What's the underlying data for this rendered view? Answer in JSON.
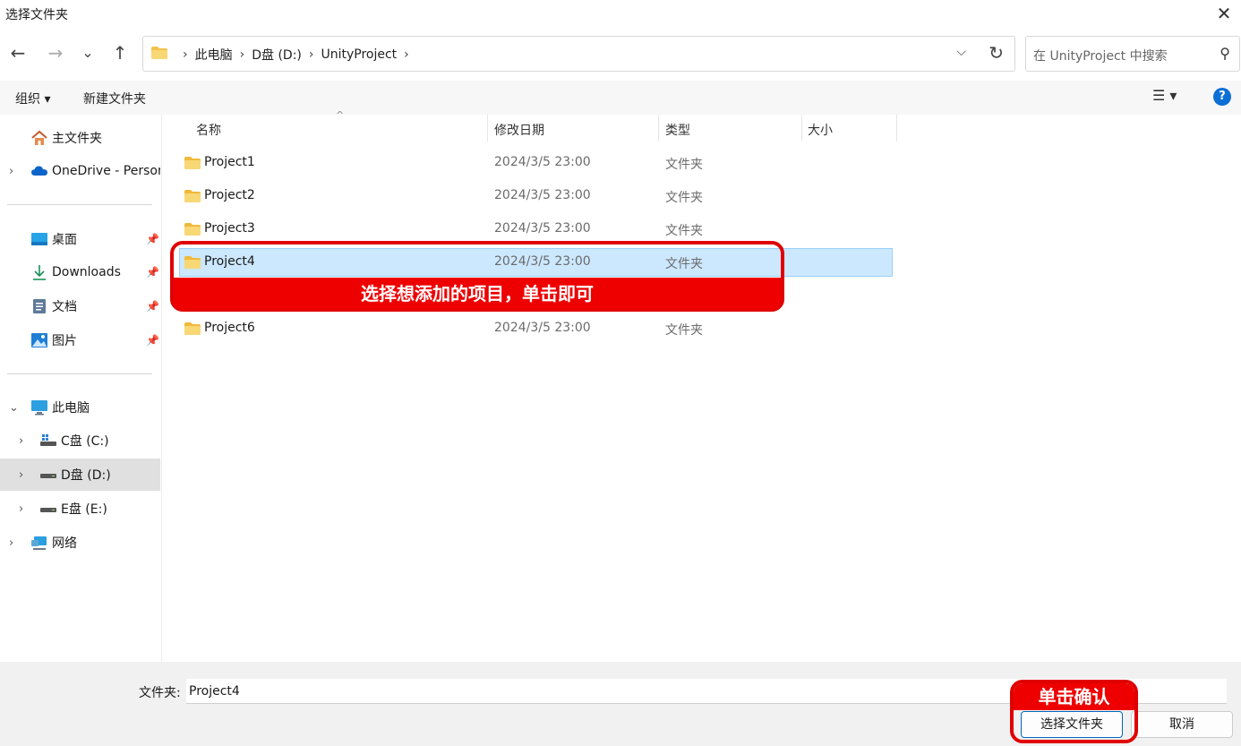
{
  "window": {
    "title": "选择文件夹",
    "close_glyph": "✕"
  },
  "nav": {
    "back": "←",
    "forward": "→",
    "recent": "⌄",
    "up": "↑",
    "breadcrumb": [
      "此电脑",
      "D盘 (D:)",
      "UnityProject"
    ],
    "sep": "›",
    "dropdown": "⌵",
    "refresh": "↻"
  },
  "search": {
    "placeholder": "在 UnityProject 中搜索",
    "icon": "⚲"
  },
  "toolbar": {
    "organize": "组织 ▾",
    "new_folder": "新建文件夹",
    "view_icon": "☰ ▾",
    "help": "?"
  },
  "sidebar": {
    "home": "主文件夹",
    "onedrive": "OneDrive - Persona",
    "desktop": "桌面",
    "downloads": "Downloads",
    "documents": "文档",
    "pictures": "图片",
    "this_pc": "此电脑",
    "c_drive": "C盘 (C:)",
    "d_drive": "D盘 (D:)",
    "e_drive": "E盘 (E:)",
    "network": "网络",
    "pin": "📌",
    "chev_right": "›",
    "chev_down": "⌄"
  },
  "columns": {
    "name": "名称",
    "modified": "修改日期",
    "type": "类型",
    "size": "大小",
    "sort_indicator": "^"
  },
  "files": [
    {
      "name": "Project1",
      "date": "2024/3/5 23:00",
      "type": "文件夹"
    },
    {
      "name": "Project2",
      "date": "2024/3/5 23:00",
      "type": "文件夹"
    },
    {
      "name": "Project3",
      "date": "2024/3/5 23:00",
      "type": "文件夹"
    },
    {
      "name": "Project4",
      "date": "2024/3/5 23:00",
      "type": "文件夹"
    },
    {
      "name": "Project6",
      "date": "2024/3/5 23:00",
      "type": "文件夹"
    }
  ],
  "annotations": {
    "select_hint": "选择想添加的项目，单击即可",
    "confirm_hint": "单击确认"
  },
  "footer": {
    "folder_label": "文件夹:",
    "folder_value": "Project4",
    "select_button": "选择文件夹",
    "cancel_button": "取消"
  },
  "colors": {
    "accent": "#0067c0",
    "selection": "#cce8ff",
    "annotation": "#ee0000",
    "folder": "#f3c14a"
  }
}
